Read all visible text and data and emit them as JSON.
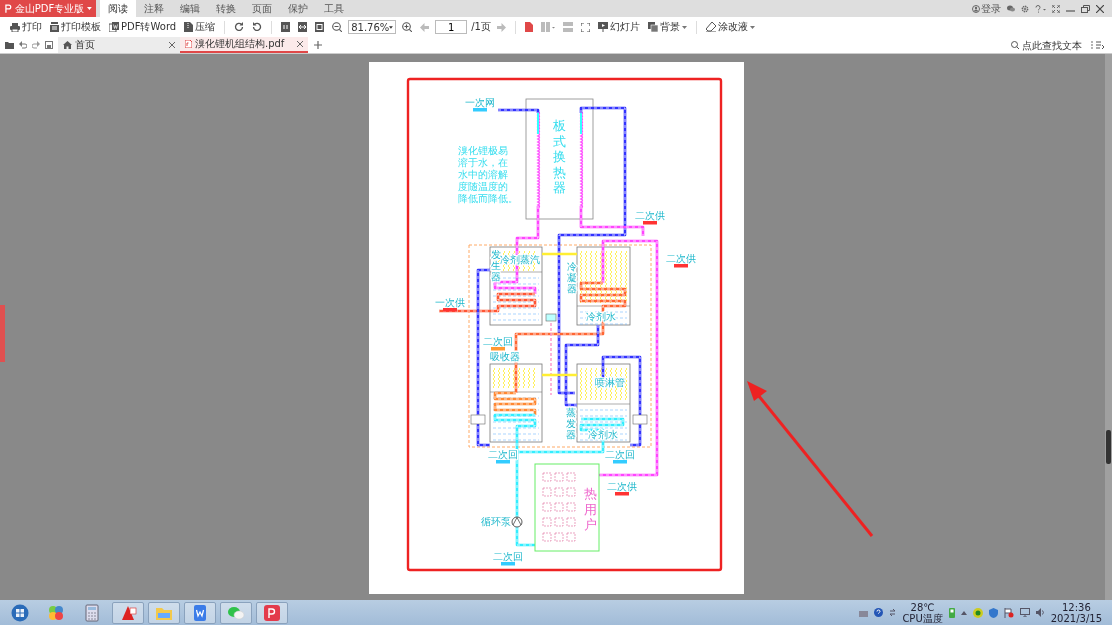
{
  "app": {
    "brand": "金山PDF专业版"
  },
  "ribbon_tabs": [
    {
      "label": "阅读",
      "selected": true
    },
    {
      "label": "注释",
      "selected": false
    },
    {
      "label": "编辑",
      "selected": false
    },
    {
      "label": "转换",
      "selected": false
    },
    {
      "label": "页面",
      "selected": false
    },
    {
      "label": "保护",
      "selected": false
    },
    {
      "label": "工具",
      "selected": false
    }
  ],
  "title_bar": {
    "login": "登录"
  },
  "toolbar": {
    "print": "打印",
    "print_template": "打印模板",
    "pdf_to_word": "PDF转Word",
    "compress": "压缩",
    "zoom": "81.76%",
    "page_input": "1",
    "page_total": "/1页",
    "slideshow": "幻灯片",
    "background": "背景",
    "whiteout": "涂改液"
  },
  "doc_tabs": [
    {
      "label": "首页",
      "kind": "home",
      "selected": false
    },
    {
      "label": "溴化锂机组结构.pdf",
      "kind": "pdf",
      "selected": true
    }
  ],
  "search": {
    "placeholder": "点此查找文本"
  },
  "diagram": {
    "exchanger": "板式换热器",
    "note_lines": [
      "溴化锂极易",
      "溶于水，在",
      "水中的溶解",
      "度随温度的",
      "降低而降低。"
    ],
    "heat_user": "热用户",
    "labels": [
      {
        "text": "一次网",
        "kind": "horizontal",
        "color": "#33ccff"
      },
      {
        "text": "二次供",
        "kind": "horizontal",
        "color": "#ff3333"
      },
      {
        "text": "发生器",
        "kind": "vertical"
      },
      {
        "text": "冷剂蒸汽",
        "kind": "horizontal"
      },
      {
        "text": "二次供",
        "kind": "horizontal",
        "color": "#ff3333"
      },
      {
        "text": "冷凝器",
        "kind": "vertical"
      },
      {
        "text": "一次供",
        "kind": "horizontal",
        "color": "#ff3333"
      },
      {
        "text": "冷剂水",
        "kind": "horizontal"
      },
      {
        "text": "二次回",
        "kind": "horizontal",
        "color": "#ff9933"
      },
      {
        "text": "吸收器",
        "kind": "horizontal"
      },
      {
        "text": "喷淋管",
        "kind": "horizontal"
      },
      {
        "text": "蒸发器",
        "kind": "vertical"
      },
      {
        "text": "冷剂水",
        "kind": "horizontal"
      },
      {
        "text": "二次回",
        "kind": "horizontal",
        "color": "#33ccff"
      },
      {
        "text": "二次回",
        "kind": "horizontal",
        "color": "#33ccff"
      },
      {
        "text": "二次供",
        "kind": "horizontal",
        "color": "#ff3333"
      },
      {
        "text": "循环泵",
        "kind": "horizontal"
      },
      {
        "text": "二次回",
        "kind": "horizontal",
        "color": "#33ccff"
      }
    ]
  },
  "taskbar": {
    "temperature": "28℃",
    "temperature_label": "CPU温度",
    "time": "12:36",
    "date": "2021/3/15"
  }
}
